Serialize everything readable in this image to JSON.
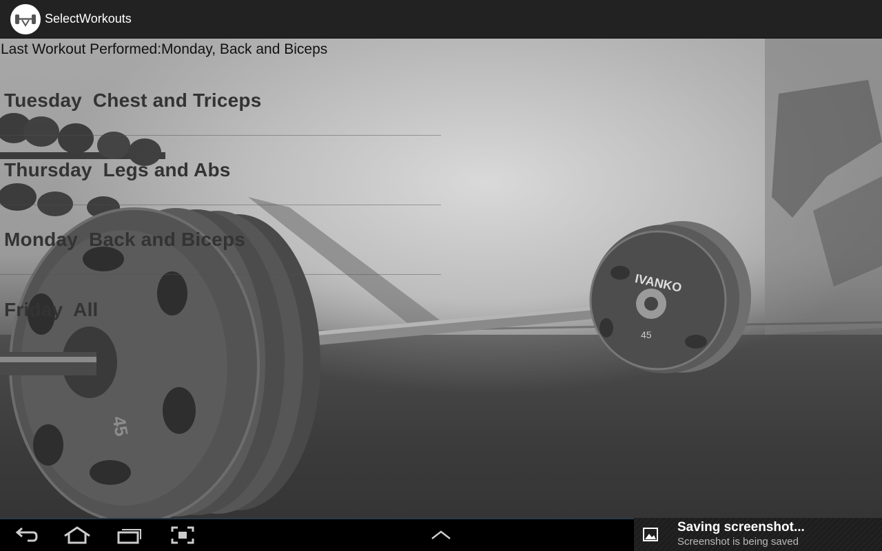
{
  "app": {
    "title": "SelectWorkouts",
    "icon": "dumbbell-app-icon"
  },
  "main": {
    "last_workout": "Last Workout Performed:Monday, Back and Biceps",
    "workouts": [
      {
        "label": "Tuesday  Chest and Triceps"
      },
      {
        "label": "Thursday  Legs and Abs"
      },
      {
        "label": "Monday  Back and Biceps"
      },
      {
        "label": "Friday  All"
      }
    ],
    "background": "gym-barbell-photo",
    "plate_text": "IVANKO",
    "plate_weight": "45"
  },
  "nav": {
    "back": "back-icon",
    "home": "home-icon",
    "recents": "recent-apps-icon",
    "screenshot": "screenshot-icon",
    "up": "chevron-up-icon"
  },
  "notification": {
    "title": "Saving screenshot...",
    "subtitle": "Screenshot is being saved"
  }
}
